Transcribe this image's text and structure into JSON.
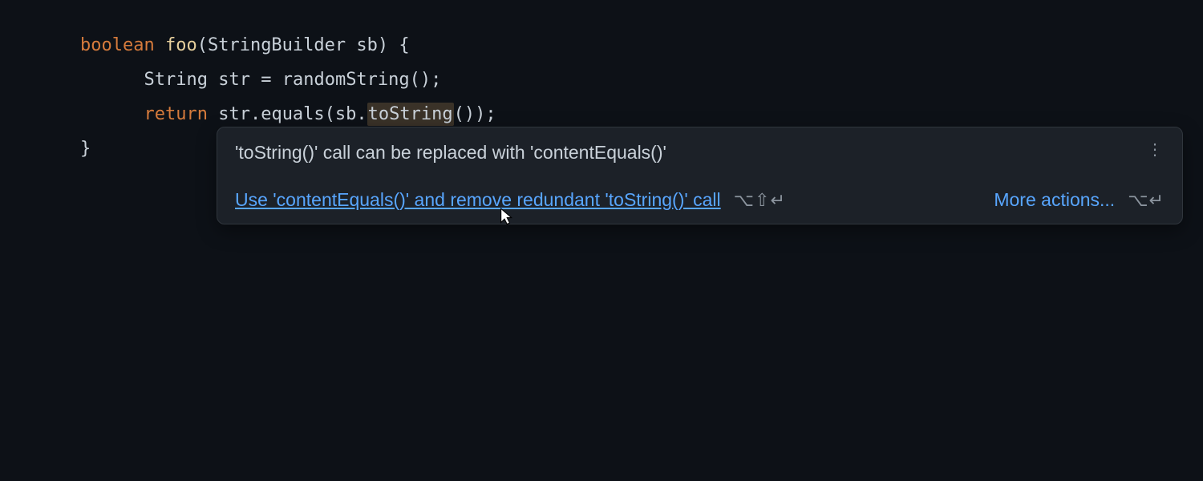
{
  "code": {
    "line1": {
      "keyword": "boolean",
      "method": "foo",
      "params": "(StringBuilder sb) {",
      "open_paren": "(",
      "param_type": "StringBuilder",
      "param_name": "sb",
      "close": ") {"
    },
    "line2": {
      "indent": "      ",
      "type": "String",
      "var": "str",
      "equals": " = ",
      "call": "randomString",
      "end": "();"
    },
    "line3": {
      "indent": "      ",
      "keyword": "return",
      "space": " ",
      "expr_start": "str.equals(sb.",
      "highlighted": "toString",
      "expr_end": "());"
    },
    "line4": {
      "close": "}"
    }
  },
  "tooltip": {
    "title": "'toString()' call can be replaced with 'contentEquals()'",
    "quick_fix": "Use 'contentEquals()' and remove redundant 'toString()' call",
    "quick_fix_shortcut": "⌥⇧↵",
    "more_actions": "More actions...",
    "more_actions_shortcut": "⌥↵"
  }
}
